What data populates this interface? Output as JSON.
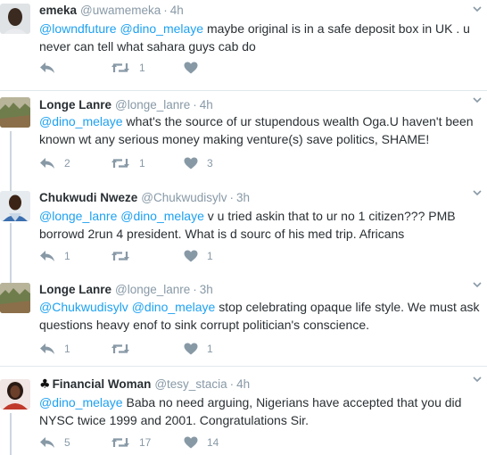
{
  "tweets": [
    {
      "name": "emeka",
      "handle": "@uwamemeka",
      "time": "4h",
      "avatar": "avatar-emeka",
      "text": [
        {
          "t": "@lowndfuture",
          "m": true
        },
        {
          "t": " ",
          "m": false
        },
        {
          "t": "@dino_melaye",
          "m": true
        },
        {
          "t": " maybe original is in a safe deposit box in UK . u never can tell what sahara guys cab do",
          "m": false
        }
      ],
      "reply_count": "",
      "retweet_count": "1",
      "like_count": ""
    },
    {
      "name": "Longe Lanre",
      "handle": "@longe_lanre",
      "time": "4h",
      "avatar": "avatar-longe",
      "text": [
        {
          "t": "@dino_melaye",
          "m": true
        },
        {
          "t": " what's the source of ur stupendous wealth Oga.U haven't been known wt any serious money making venture(s) save politics, SHAME!",
          "m": false
        }
      ],
      "reply_count": "2",
      "retweet_count": "1",
      "like_count": "3"
    },
    {
      "name": "Chukwudi Nweze",
      "handle": "@Chukwudisylv",
      "time": "3h",
      "avatar": "avatar-chukwudi",
      "text": [
        {
          "t": "@longe_lanre",
          "m": true
        },
        {
          "t": " ",
          "m": false
        },
        {
          "t": "@dino_melaye",
          "m": true
        },
        {
          "t": " v u tried askin that to ur no 1 citizen??? PMB borrowd 2run 4 president. What is d sourc of his med trip. Africans",
          "m": false
        }
      ],
      "reply_count": "1",
      "retweet_count": "",
      "like_count": "1"
    },
    {
      "name": "Longe Lanre",
      "handle": "@longe_lanre",
      "time": "3h",
      "avatar": "avatar-longe",
      "text": [
        {
          "t": "@Chukwudisylv",
          "m": true
        },
        {
          "t": " ",
          "m": false
        },
        {
          "t": "@dino_melaye",
          "m": true
        },
        {
          "t": " stop celebrating opaque life style. We must ask questions heavy enof to sink corrupt politician's conscience.",
          "m": false
        }
      ],
      "reply_count": "1",
      "retweet_count": "",
      "like_count": "1"
    },
    {
      "name": "Financial Woman",
      "name_prefix": "♣",
      "handle": "@tesy_stacia",
      "time": "4h",
      "avatar": "avatar-financial",
      "text": [
        {
          "t": "@dino_melaye",
          "m": true
        },
        {
          "t": " Baba no need arguing, Nigerians have accepted that you did NYSC twice 1999 and 2001. Congratulations Sir.",
          "m": false
        }
      ],
      "reply_count": "5",
      "retweet_count": "17",
      "like_count": "14"
    }
  ],
  "colors": {
    "mention": "#1da1f2",
    "meta": "#8899a6",
    "text": "#292f33",
    "thread_line": "#ccd6dd",
    "divider": "#e1e8ed"
  },
  "icons": {
    "reply": "reply-icon",
    "retweet": "retweet-icon",
    "like": "heart-icon",
    "more": "chevron-down-icon"
  }
}
